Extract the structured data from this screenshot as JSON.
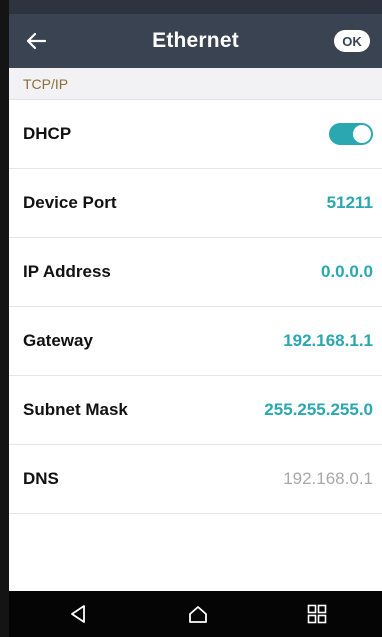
{
  "header": {
    "title": "Ethernet",
    "ok_label": "OK",
    "back_icon": "arrow-left-icon"
  },
  "section": {
    "title": "TCP/IP"
  },
  "settings": {
    "dhcp": {
      "label": "DHCP",
      "enabled": true
    },
    "device_port": {
      "label": "Device Port",
      "value": "51211"
    },
    "ip_address": {
      "label": "IP Address",
      "value": "0.0.0.0"
    },
    "gateway": {
      "label": "Gateway",
      "value": "192.168.1.1"
    },
    "subnet_mask": {
      "label": "Subnet Mask",
      "value": "255.255.255.0"
    },
    "dns": {
      "label": "DNS",
      "value": "192.168.0.1"
    }
  },
  "navbar": {
    "back_icon": "triangle-back-icon",
    "home_icon": "home-icon",
    "apps_icon": "grid-apps-icon"
  },
  "colors": {
    "header_bg": "#3a4351",
    "accent": "#2aa7b0",
    "section_text": "#8a6d3b",
    "muted_value": "#a8a8a8"
  }
}
